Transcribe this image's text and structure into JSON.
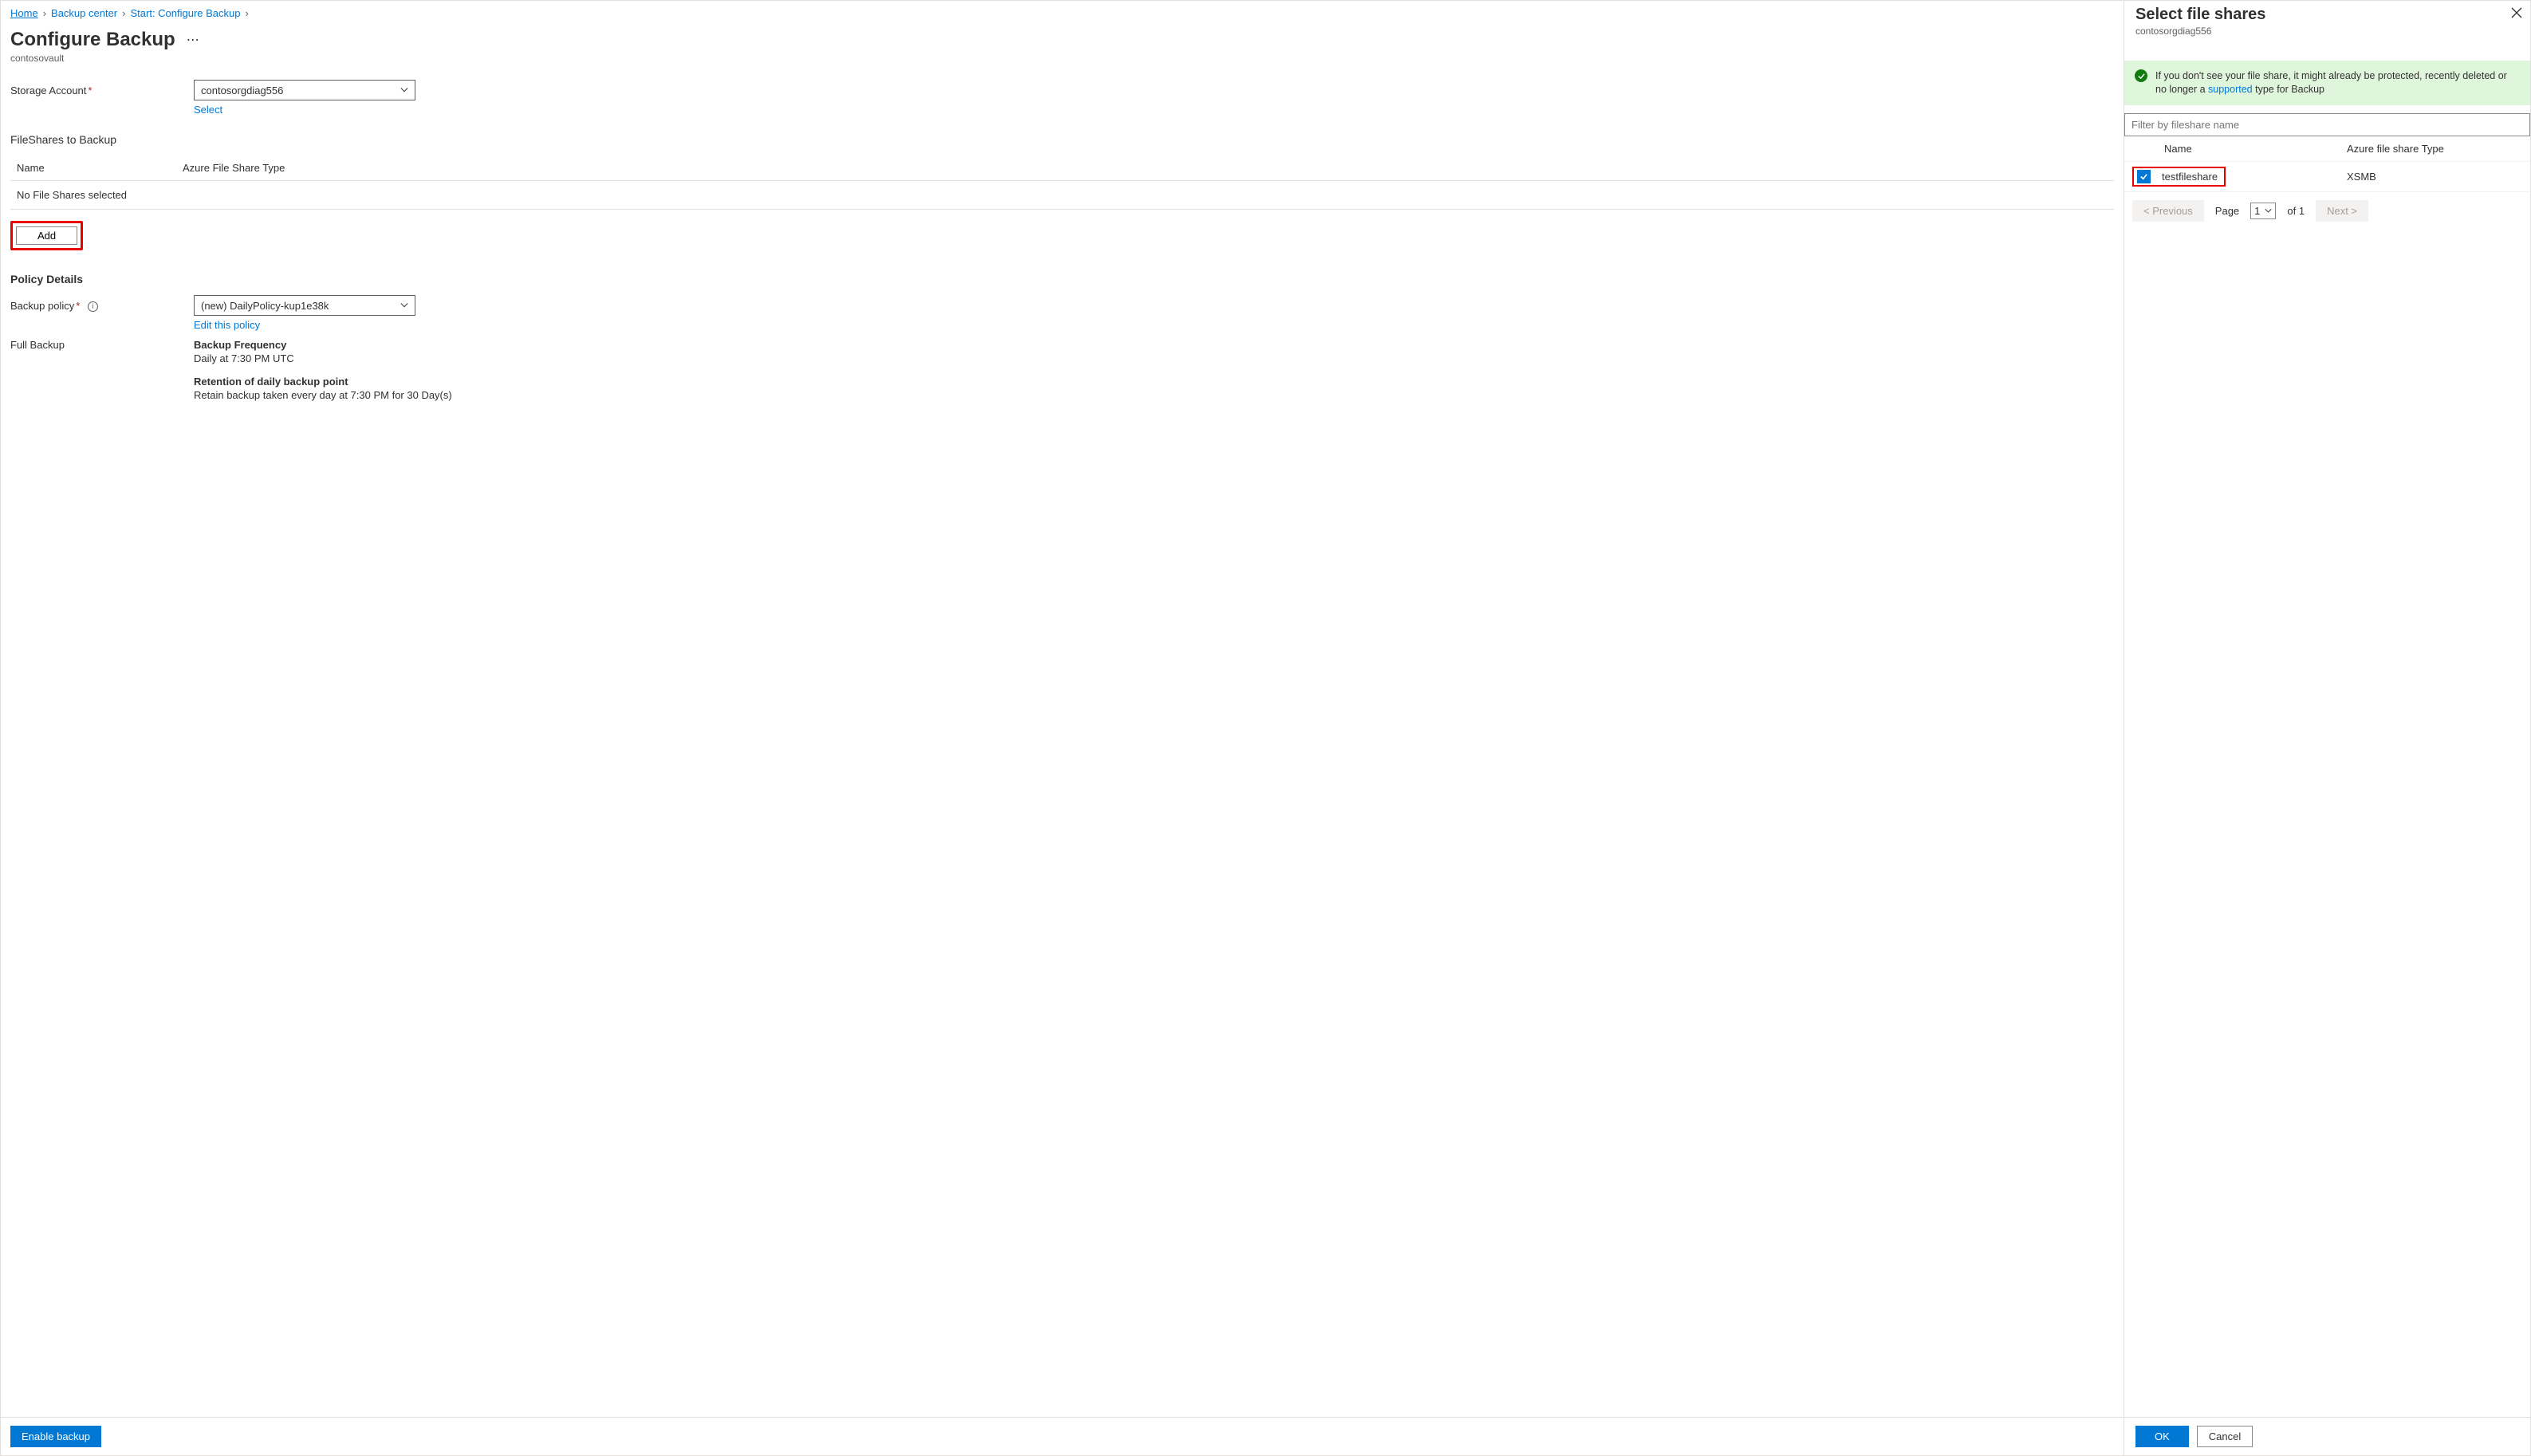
{
  "breadcrumb": {
    "home": "Home",
    "backup_center": "Backup center",
    "start_configure": "Start: Configure Backup"
  },
  "header": {
    "title": "Configure Backup",
    "subtitle": "contosovault"
  },
  "storage": {
    "label": "Storage Account",
    "value": "contosorgdiag556",
    "select_link": "Select"
  },
  "fileshares": {
    "heading": "FileShares to Backup",
    "col_name": "Name",
    "col_type": "Azure File Share Type",
    "empty": "No File Shares selected",
    "add_btn": "Add"
  },
  "policy": {
    "heading": "Policy Details",
    "label": "Backup policy",
    "value": "(new) DailyPolicy-kup1e38k",
    "edit_link": "Edit this policy",
    "full_backup_label": "Full Backup",
    "freq_heading": "Backup Frequency",
    "freq_text": "Daily at 7:30 PM UTC",
    "retention_heading": "Retention of daily backup point",
    "retention_text": "Retain backup taken every day at 7:30 PM for 30 Day(s)"
  },
  "footer": {
    "enable": "Enable backup"
  },
  "side": {
    "title": "Select file shares",
    "subtitle": "contosorgdiag556",
    "banner_pre": "If you don't see your file share, it might already be protected, recently deleted or no longer a ",
    "banner_link": "supported",
    "banner_post": " type for Backup",
    "filter_placeholder": "Filter by fileshare name",
    "col_name": "Name",
    "col_type": "Azure file share Type",
    "row_name": "testfileshare",
    "row_type": "XSMB",
    "prev": "< Previous",
    "page_label": "Page",
    "page_val": "1",
    "page_of": "of 1",
    "next": "Next >",
    "ok": "OK",
    "cancel": "Cancel"
  }
}
